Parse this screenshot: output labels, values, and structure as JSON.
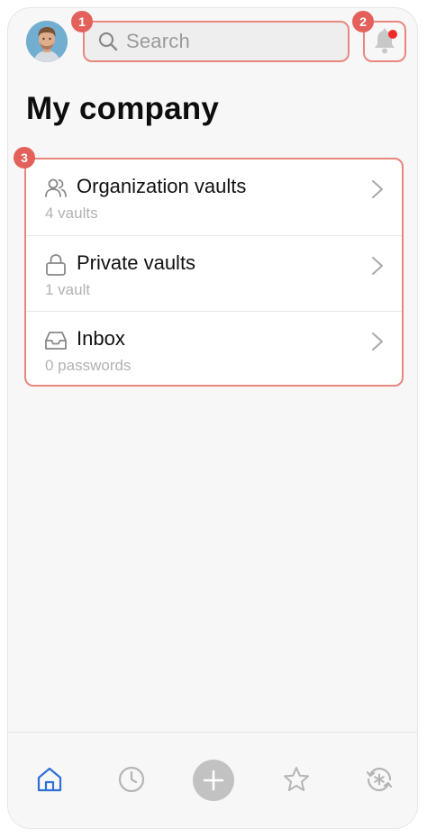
{
  "header": {
    "search": {
      "placeholder": "Search",
      "icon": "search-icon"
    },
    "notifications": {
      "icon": "bell-icon",
      "has_unread": true
    }
  },
  "annotations": [
    "1",
    "2",
    "3"
  ],
  "page_title": "My company",
  "vault_list": [
    {
      "label": "Organization vaults",
      "sublabel": "4 vaults",
      "icon": "users-icon"
    },
    {
      "label": "Private vaults",
      "sublabel": "1 vault",
      "icon": "lock-icon"
    },
    {
      "label": "Inbox",
      "sublabel": "0 passwords",
      "icon": "inbox-icon"
    }
  ],
  "tabbar": {
    "tabs": [
      {
        "icon": "home-icon",
        "active": true
      },
      {
        "icon": "clock-icon",
        "active": false
      },
      {
        "icon": "plus-icon",
        "active": false
      },
      {
        "icon": "star-icon",
        "active": false
      },
      {
        "icon": "sync-asterisk-icon",
        "active": false
      }
    ]
  },
  "colors": {
    "highlight_border": "#e8877e",
    "annotation_badge": "#e3615a",
    "notification_dot": "#f12a2a",
    "active_tab": "#2f6fd6",
    "inactive_icon": "#b5b5b5"
  }
}
